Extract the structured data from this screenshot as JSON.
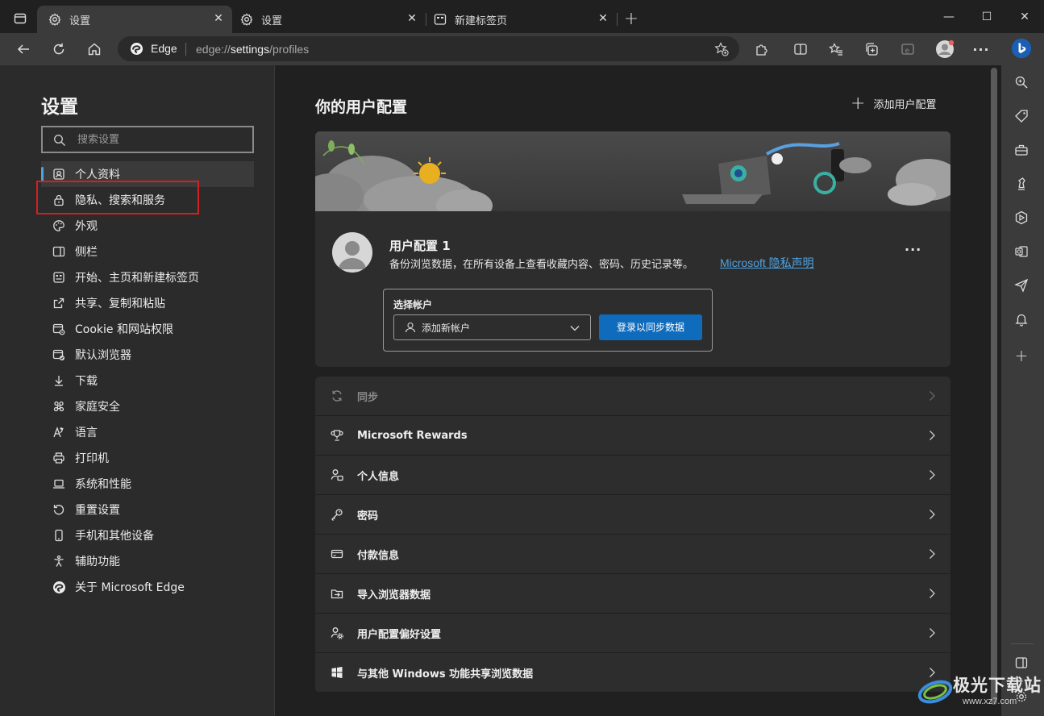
{
  "tabs": [
    {
      "title": "设置",
      "icon": "gear-icon",
      "active": true
    },
    {
      "title": "设置",
      "icon": "gear-icon",
      "active": false
    },
    {
      "title": "新建标签页",
      "icon": "new-tab-page-icon",
      "active": false
    }
  ],
  "window_controls": {
    "minimize": "—",
    "maximize": "☐",
    "close": "✕"
  },
  "address_bar": {
    "site_label": "Edge",
    "url_prefix": "edge://",
    "url_host": "settings",
    "url_path": "/profiles"
  },
  "left_nav": {
    "title": "设置",
    "search_placeholder": "搜索设置",
    "items": [
      {
        "label": "个人资料",
        "icon": "profile-icon",
        "selected": true
      },
      {
        "label": "隐私、搜索和服务",
        "icon": "lock-icon",
        "selected": false
      },
      {
        "label": "外观",
        "icon": "palette-icon",
        "selected": false
      },
      {
        "label": "侧栏",
        "icon": "sidebar-icon",
        "selected": false
      },
      {
        "label": "开始、主页和新建标签页",
        "icon": "home-page-icon",
        "selected": false
      },
      {
        "label": "共享、复制和粘贴",
        "icon": "share-icon",
        "selected": false
      },
      {
        "label": "Cookie 和网站权限",
        "icon": "site-permissions-icon",
        "selected": false
      },
      {
        "label": "默认浏览器",
        "icon": "default-browser-icon",
        "selected": false
      },
      {
        "label": "下载",
        "icon": "download-icon",
        "selected": false
      },
      {
        "label": "家庭安全",
        "icon": "family-icon",
        "selected": false
      },
      {
        "label": "语言",
        "icon": "language-icon",
        "selected": false
      },
      {
        "label": "打印机",
        "icon": "printer-icon",
        "selected": false
      },
      {
        "label": "系统和性能",
        "icon": "laptop-icon",
        "selected": false
      },
      {
        "label": "重置设置",
        "icon": "reset-icon",
        "selected": false
      },
      {
        "label": "手机和其他设备",
        "icon": "phone-icon",
        "selected": false
      },
      {
        "label": "辅助功能",
        "icon": "accessibility-icon",
        "selected": false
      },
      {
        "label": "关于 Microsoft Edge",
        "icon": "edge-logo-icon",
        "selected": false
      }
    ]
  },
  "main": {
    "title": "你的用户配置",
    "add_profile_label": "添加用户配置",
    "profile": {
      "name": "用户配置 1",
      "description": "备份浏览数据，在所有设备上查看收藏内容、密码、历史记录等。",
      "privacy_link": "Microsoft 隐私声明",
      "more_label": "···",
      "account_label": "选择帐户",
      "account_select_value": "添加新帐户",
      "sign_in_button": "登录以同步数据"
    },
    "settings_rows": [
      {
        "label": "同步",
        "icon": "sync-icon",
        "disabled": true
      },
      {
        "label": "Microsoft Rewards",
        "icon": "trophy-icon",
        "disabled": false
      },
      {
        "label": "个人信息",
        "icon": "person-info-icon",
        "disabled": false
      },
      {
        "label": "密码",
        "icon": "key-icon",
        "disabled": false
      },
      {
        "label": "付款信息",
        "icon": "credit-card-icon",
        "disabled": false
      },
      {
        "label": "导入浏览器数据",
        "icon": "import-icon",
        "disabled": false
      },
      {
        "label": "用户配置偏好设置",
        "icon": "profile-settings-icon",
        "disabled": false
      },
      {
        "label": "与其他 Windows 功能共享浏览数据",
        "icon": "windows-icon",
        "disabled": false
      }
    ]
  },
  "watermark": {
    "text": "极光下载站",
    "sub": "www.xz7.com"
  },
  "colors": {
    "accent": "#0f6cbd",
    "link": "#4fa3e0",
    "highlight_box": "#d42020"
  }
}
